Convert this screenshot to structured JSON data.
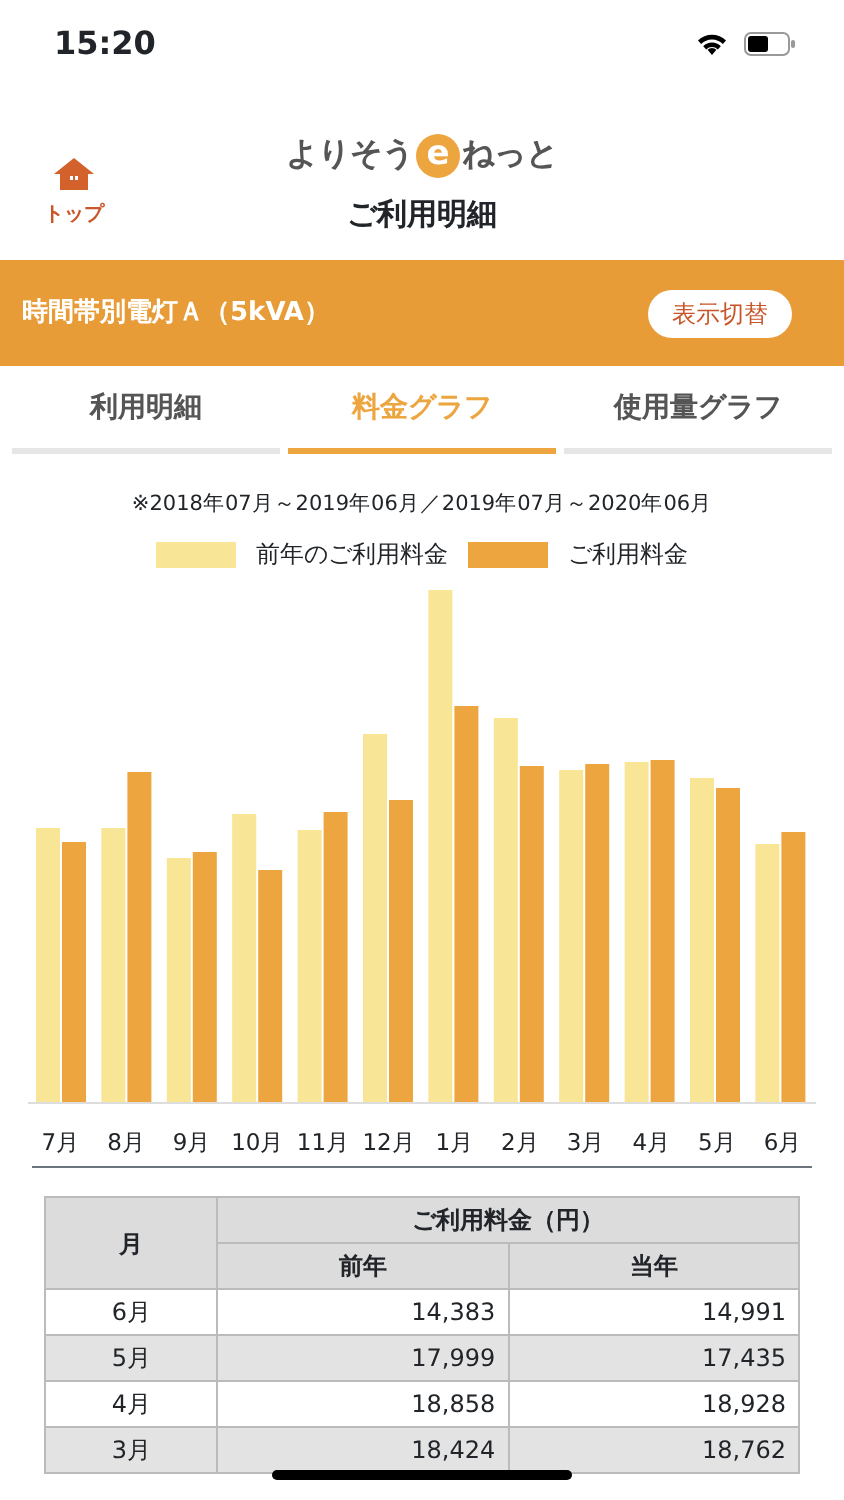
{
  "status_bar": {
    "time": "15:20"
  },
  "header": {
    "back_label": "トップ",
    "logo": {
      "before": "よりそう",
      "badge": "e",
      "after": "ねっと"
    },
    "title": "ご利用明細"
  },
  "plan_bar": {
    "plan": "時間帯別電灯Ａ（5kVA）",
    "button": "表示切替"
  },
  "tabs": [
    {
      "label": "利用明細",
      "selected": false
    },
    {
      "label": "料金グラフ",
      "selected": true
    },
    {
      "label": "使用量グラフ",
      "selected": false
    }
  ],
  "chart": {
    "period": "※2018年07月～2019年06月／2019年07月～2020年06月",
    "legend": [
      {
        "label": "前年のご利用料金",
        "color": "#f9e596"
      },
      {
        "label": "ご利用料金",
        "color": "#eda63f"
      }
    ],
    "months": [
      "7月",
      "8月",
      "9月",
      "10月",
      "11月",
      "12月",
      "1月",
      "2月",
      "3月",
      "4月",
      "5月",
      "6月"
    ]
  },
  "table": {
    "month_header": "月",
    "group_header": "ご利用料金（円）",
    "columns": [
      "前年",
      "当年"
    ],
    "rows": [
      {
        "month": "6月",
        "prev": "14,383",
        "cur": "14,991"
      },
      {
        "month": "5月",
        "prev": "17,999",
        "cur": "17,435"
      },
      {
        "month": "4月",
        "prev": "18,858",
        "cur": "18,928"
      },
      {
        "month": "3月",
        "prev": "18,424",
        "cur": "18,762"
      }
    ]
  }
}
